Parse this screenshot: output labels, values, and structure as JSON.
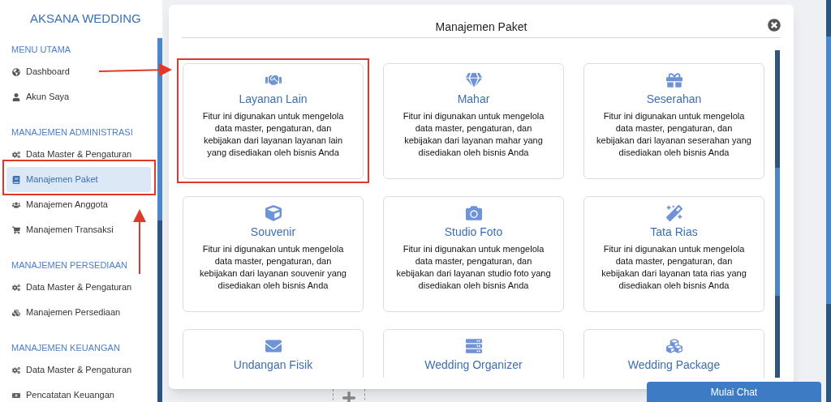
{
  "sidebar": {
    "brand": "AKSANA WEDDING",
    "sections": [
      {
        "title": "MENU UTAMA",
        "items": [
          {
            "label": "Dashboard",
            "selected": false
          },
          {
            "label": "Akun Saya",
            "selected": false
          }
        ]
      },
      {
        "title": "MANAJEMEN ADMINISTRASI",
        "items": [
          {
            "label": "Data Master & Pengaturan",
            "selected": false
          },
          {
            "label": "Manajemen Paket",
            "selected": true
          },
          {
            "label": "Manajemen Anggota",
            "selected": false
          },
          {
            "label": "Manajemen Transaksi",
            "selected": false
          }
        ]
      },
      {
        "title": "MANAJEMEN PERSEDIAAN",
        "items": [
          {
            "label": "Data Master & Pengaturan",
            "selected": false
          },
          {
            "label": "Manajemen Persediaan",
            "selected": false
          }
        ]
      },
      {
        "title": "MANAJEMEN KEUANGAN",
        "items": [
          {
            "label": "Data Master & Pengaturan",
            "selected": false
          },
          {
            "label": "Pencatatan Keuangan",
            "selected": false
          }
        ]
      }
    ]
  },
  "modal": {
    "title": "Manajemen Paket",
    "cards": [
      {
        "title": "Layanan Lain",
        "description": "Fitur ini digunakan untuk mengelola data master, pengaturan, dan kebijakan dari layanan layanan lain yang disediakan oleh bisnis Anda"
      },
      {
        "title": "Mahar",
        "description": "Fitur ini digunakan untuk mengelola data master, pengaturan, dan kebijakan dari layanan mahar yang disediakan oleh bisnis Anda"
      },
      {
        "title": "Seserahan",
        "description": "Fitur ini digunakan untuk mengelola data master, pengaturan, dan kebijakan dari layanan seserahan yang disediakan oleh bisnis Anda"
      },
      {
        "title": "Souvenir",
        "description": "Fitur ini digunakan untuk mengelola data master, pengaturan, dan kebijakan dari layanan souvenir yang disediakan oleh bisnis Anda"
      },
      {
        "title": "Studio Foto",
        "description": "Fitur ini digunakan untuk mengelola data master, pengaturan, dan kebijakan dari layanan studio foto yang disediakan oleh bisnis Anda"
      },
      {
        "title": "Tata Rias",
        "description": "Fitur ini digunakan untuk mengelola data master, pengaturan, dan kebijakan dari layanan tata rias yang disediakan oleh bisnis Anda"
      },
      {
        "title": "Undangan Fisik"
      },
      {
        "title": "Wedding Organizer"
      },
      {
        "title": "Wedding Package"
      }
    ]
  },
  "chat_button": "Mulai Chat"
}
